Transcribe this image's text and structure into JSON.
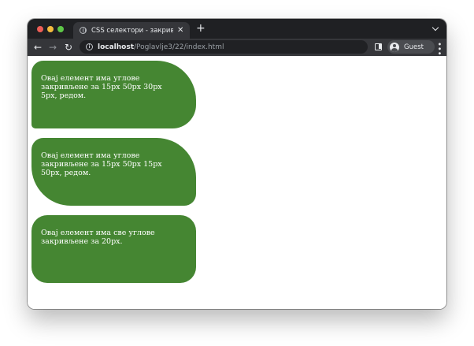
{
  "browser": {
    "tab": {
      "title": "CSS селектори - закривљење",
      "favicon": "globe-icon"
    },
    "new_tab_label": "+",
    "toolbar": {
      "url_host": "localhost",
      "url_path": "/Poglavlje3/22/index.html",
      "profile_name": "Guest"
    }
  },
  "page": {
    "boxes": [
      {
        "text": "Овај елемент има углове закривљене за 15px 50px 30px 5px, редом."
      },
      {
        "text": "Овај елемент има углове закривљене за 15px 50px 15px 50px, редом."
      },
      {
        "text": "Овај елемент има све углове закривљене за 20px."
      }
    ],
    "box_color": "#458632"
  }
}
